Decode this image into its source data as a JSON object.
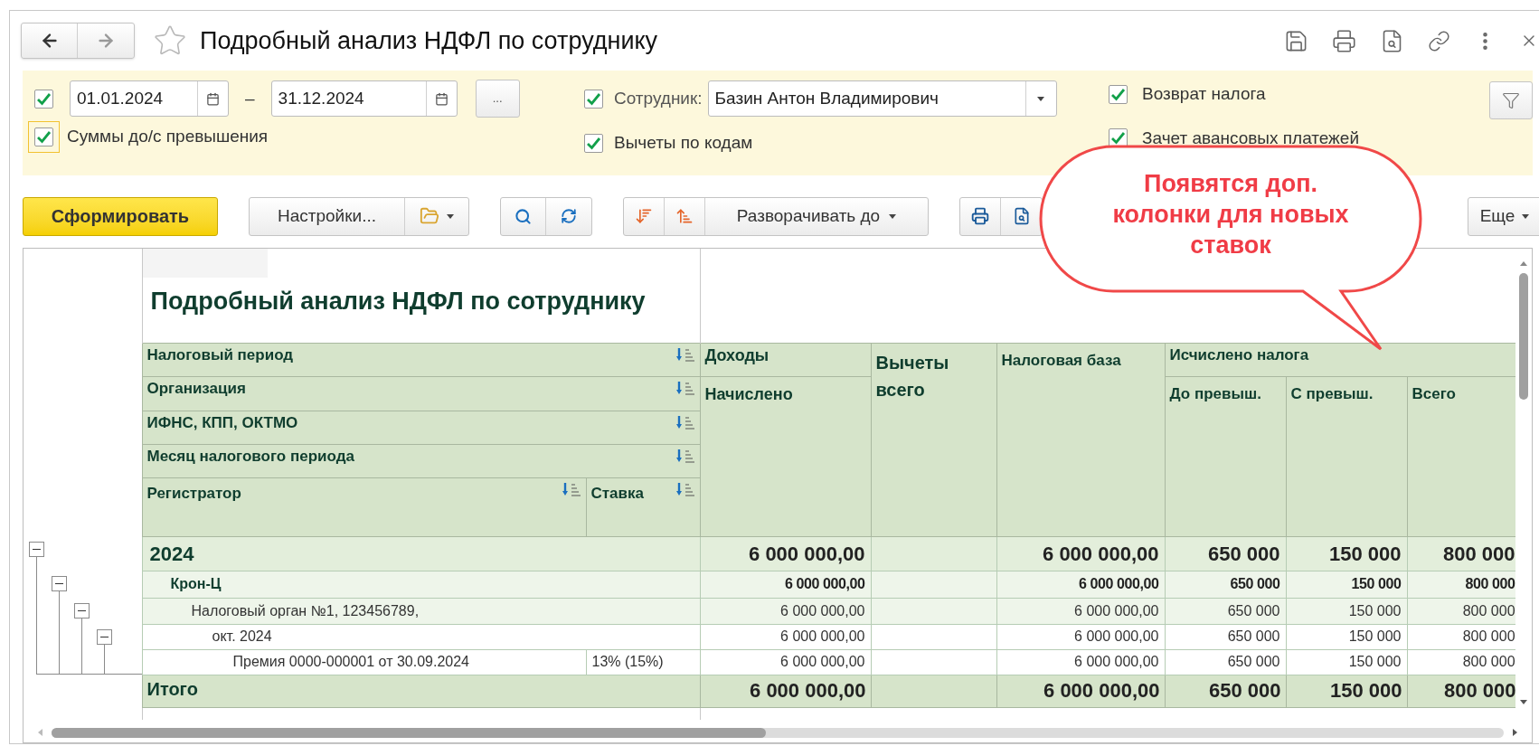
{
  "window": {
    "title": "Подробный анализ НДФЛ по сотруднику"
  },
  "filters": {
    "period": {
      "checked": true,
      "from": "01.01.2024",
      "separator": "–",
      "to": "31.12.2024",
      "more": "..."
    },
    "exceed": {
      "checked": true,
      "focused": true,
      "label": "Суммы до/с превышения"
    },
    "employee": {
      "checked": true,
      "label": "Сотрудник:",
      "value": "Базин Антон Владимирович"
    },
    "deductions": {
      "checked": true,
      "label": "Вычеты по кодам"
    },
    "refund": {
      "checked": true,
      "label": "Возврат налога"
    },
    "advance": {
      "checked": true,
      "label": "Зачет авансовых платежей"
    }
  },
  "toolbar": {
    "generate": "Сформировать",
    "settings": "Настройки...",
    "expand": "Разворачивать до",
    "more": "Еще"
  },
  "callout": {
    "text": "Появятся доп. колонки для новых ставок"
  },
  "report": {
    "title": "Подробный анализ НДФЛ по сотруднику",
    "grouping": [
      "Налоговый период",
      "Организация",
      "ИФНС, КПП, ОКТМО",
      "Месяц налогового периода"
    ],
    "registrar": "Регистратор",
    "rate": "Ставка",
    "income": {
      "title": "Доходы",
      "sub": "Начислено"
    },
    "deductions": "Вычеты всего",
    "base": "Налоговая база",
    "tax": {
      "title": "Исчислено налога",
      "columns": [
        "До превыш.",
        "С превыш.",
        "Всего"
      ]
    },
    "rows": [
      {
        "label": "2024",
        "expanded": true,
        "income": "6 000 000,00",
        "base": "6 000 000,00",
        "tax": [
          "650 000",
          "150 000",
          "800 000"
        ],
        "children": [
          {
            "label": "Крон-Ц",
            "expanded": true,
            "income": "6 000 000,00",
            "base": "6 000 000,00",
            "tax": [
              "650 000",
              "150 000",
              "800 000"
            ],
            "children": [
              {
                "label": "Налоговый орган №1, 123456789,",
                "expanded": true,
                "income": "6 000 000,00",
                "base": "6 000 000,00",
                "tax": [
                  "650 000",
                  "150 000",
                  "800 000"
                ],
                "children": [
                  {
                    "label": "окт. 2024",
                    "expanded": true,
                    "income": "6 000 000,00",
                    "base": "6 000 000,00",
                    "tax": [
                      "650 000",
                      "150 000",
                      "800 000"
                    ],
                    "children": [
                      {
                        "label": "Премия 0000-000001 от 30.09.2024",
                        "rate": "13% (15%)",
                        "income": "6 000 000,00",
                        "base": "6 000 000,00",
                        "tax": [
                          "650 000",
                          "150 000",
                          "800 000"
                        ]
                      }
                    ]
                  }
                ]
              }
            ]
          }
        ]
      }
    ],
    "total": {
      "label": "Итого",
      "income": "6 000 000,00",
      "base": "6 000 000,00",
      "tax": [
        "650 000",
        "150 000",
        "800 000"
      ]
    }
  }
}
